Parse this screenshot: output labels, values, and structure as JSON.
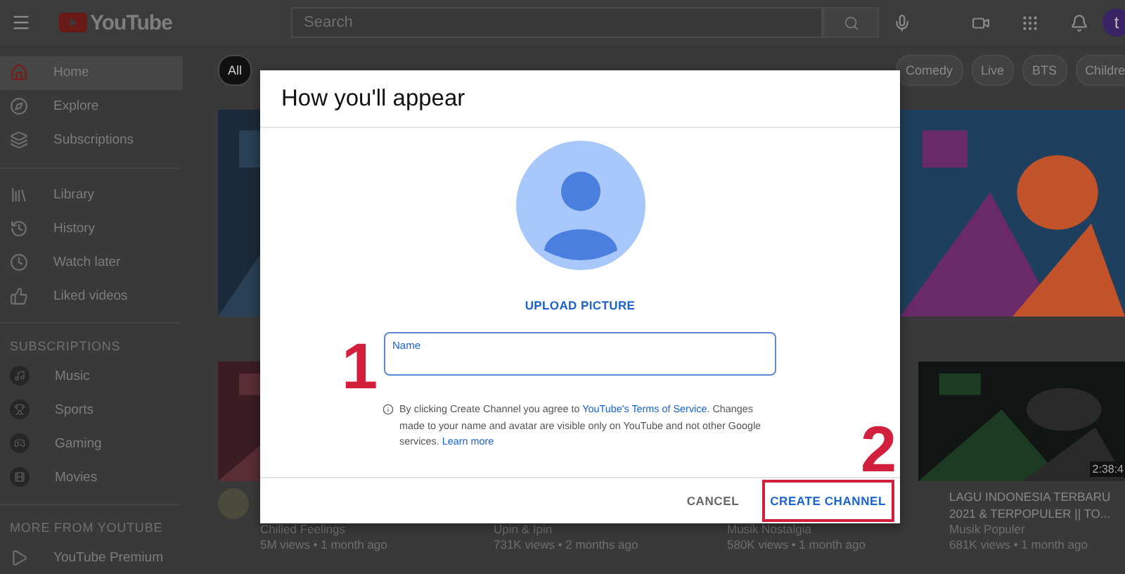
{
  "header": {
    "logo": "YouTube",
    "search": {
      "placeholder": "Search"
    },
    "avatar": "t"
  },
  "sidebar": {
    "sections": [
      {
        "items": [
          {
            "label": "Home",
            "selected": true
          },
          {
            "label": "Explore",
            "selected": false
          },
          {
            "label": "Subscriptions",
            "selected": false
          }
        ]
      },
      {
        "items": [
          {
            "label": "Library",
            "selected": false
          },
          {
            "label": "History",
            "selected": false
          },
          {
            "label": "Watch later",
            "selected": false
          },
          {
            "label": "Liked videos",
            "selected": false
          }
        ]
      },
      {
        "heading": "SUBSCRIPTIONS",
        "items": [
          {
            "label": "Music",
            "selected": false
          },
          {
            "label": "Sports",
            "selected": false
          },
          {
            "label": "Gaming",
            "selected": false
          },
          {
            "label": "Movies",
            "selected": false
          }
        ]
      },
      {
        "heading": "MORE FROM YOUTUBE",
        "items": [
          {
            "label": "YouTube Premium",
            "selected": false
          }
        ]
      }
    ]
  },
  "chips": [
    {
      "label": "All",
      "selected": true
    },
    {
      "label": "Comedy",
      "selected": false
    },
    {
      "label": "Live",
      "selected": false
    },
    {
      "label": "BTS",
      "selected": false
    },
    {
      "label": "Childre",
      "selected": false
    }
  ],
  "videos": [
    {
      "channel": "Chilled Feelings",
      "meta": "5M views • 1 month ago"
    },
    {
      "channel": "Upin & Ipin",
      "meta": "731K views • 2 months ago"
    },
    {
      "channel": "Musik Nostalgia",
      "meta": "580K views • 1 month ago"
    },
    {
      "duration": "2:38:4",
      "title": "LAGU INDONESIA TERBARU 2021 & TERPOPULER || TO...",
      "channel": "Musik Populer",
      "meta": "681K views • 1 month ago"
    }
  ],
  "dialog": {
    "title": "How you'll appear",
    "upload": "UPLOAD PICTURE",
    "field": {
      "label": "Name",
      "focused": true
    },
    "notice": "By clicking Create Channel you agree to ",
    "notice_link": "YouTube's Terms of Service",
    "notice_rest": ". Changes made to your name and avatar are visible only on YouTube and not other Google services. ",
    "notice_link2": "Learn more",
    "buttons": [
      {
        "label": "CANCEL",
        "kind": "plain",
        "highlighted": false
      },
      {
        "label": "CREATE CHANNEL",
        "kind": "primary",
        "highlighted": true
      }
    ]
  },
  "annotations": [
    {
      "label": "1"
    },
    {
      "label": "2"
    }
  ]
}
